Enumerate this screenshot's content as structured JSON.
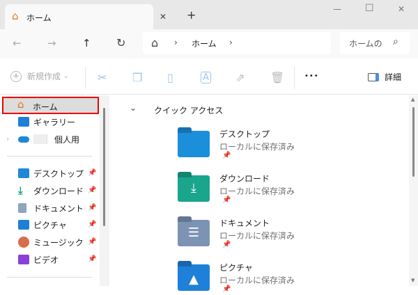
{
  "window": {
    "tab_title": "ホーム",
    "new_tab": "+",
    "minimize": "—",
    "maximize": "☐",
    "close": "✕",
    "tab_close": "✕"
  },
  "nav": {
    "back": "←",
    "forward": "→",
    "up": "↑",
    "refresh": "↻",
    "breadcrumb": [
      "ホーム"
    ],
    "sep": "›",
    "search_placeholder": "ホームの",
    "search_icon": "⌕"
  },
  "toolbar": {
    "new_label": "新規作成",
    "new_chevron": "⌄",
    "more": "•••",
    "details_label": "詳細"
  },
  "sidebar": {
    "top": [
      {
        "label": "ホーム",
        "selected": true
      },
      {
        "label": "ギャラリー"
      },
      {
        "label": "個人用"
      }
    ],
    "pinned": [
      {
        "label": "デスクトップ",
        "color": "#1e88d6"
      },
      {
        "label": "ダウンロード",
        "color": "#1aa38a"
      },
      {
        "label": "ドキュメント",
        "color": "#8fa4bf"
      },
      {
        "label": "ピクチャ",
        "color": "#1e7fd6"
      },
      {
        "label": "ミュージック",
        "color": "#d86d4a"
      },
      {
        "label": "ビデオ",
        "color": "#8a3fd6"
      }
    ]
  },
  "main": {
    "section_title": "クイック アクセス",
    "items": [
      {
        "name": "デスクトップ",
        "status": "ローカルに保存済み",
        "color": "#1c8fdb"
      },
      {
        "name": "ダウンロード",
        "status": "ローカルに保存済み",
        "color": "#1aa58d"
      },
      {
        "name": "ドキュメント",
        "status": "ローカルに保存済み",
        "color": "#7d93b4"
      },
      {
        "name": "ピクチャ",
        "status": "ローカルに保存済み",
        "color": "#1e80d8"
      }
    ]
  }
}
